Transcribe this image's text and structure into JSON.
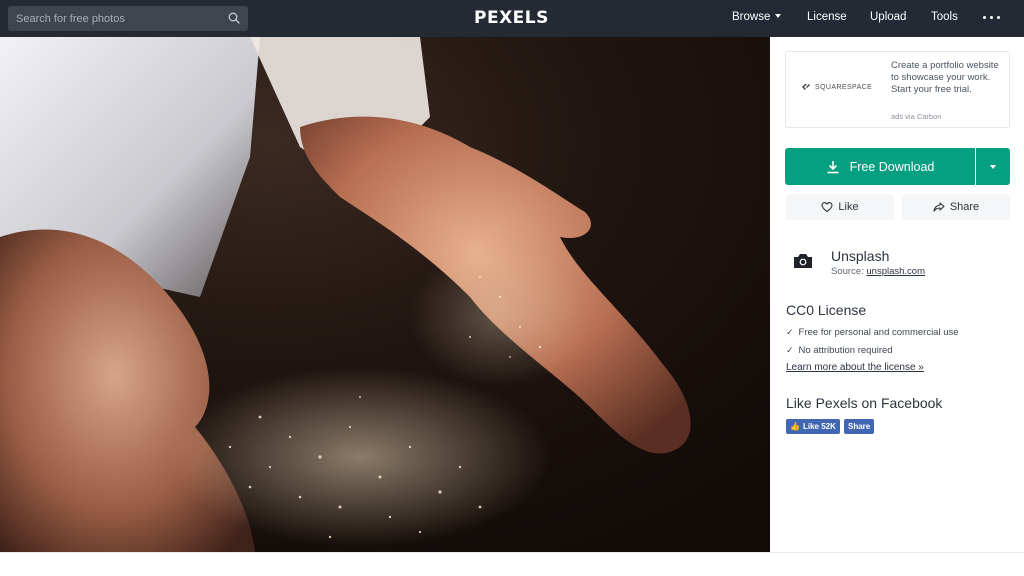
{
  "header": {
    "search_placeholder": "Search for free photos",
    "logo": "PEXELS",
    "nav": {
      "browse": "Browse",
      "license": "License",
      "upload": "Upload",
      "tools": "Tools"
    },
    "more_icon": "ellipsis-icon"
  },
  "sidebar": {
    "ad": {
      "brand": "SQUARESPACE",
      "text": "Create a portfolio website to showcase your work. Start your free trial.",
      "via": "ads via Carbon"
    },
    "download_label": "Free Download",
    "like_label": "Like",
    "share_label": "Share",
    "source": {
      "name": "Unsplash",
      "prefix": "Source:",
      "link": "unsplash.com"
    },
    "license": {
      "title": "CC0 License",
      "items": [
        "Free for personal and commercial use",
        "No attribution required"
      ],
      "learn_more": "Learn more about the license »"
    },
    "facebook": {
      "title": "Like Pexels on Facebook",
      "like_label": "Like 52K",
      "share_label": "Share"
    }
  },
  "colors": {
    "topbar": "#232a34",
    "accent_green": "#05a081",
    "facebook_blue": "#4267b2"
  }
}
